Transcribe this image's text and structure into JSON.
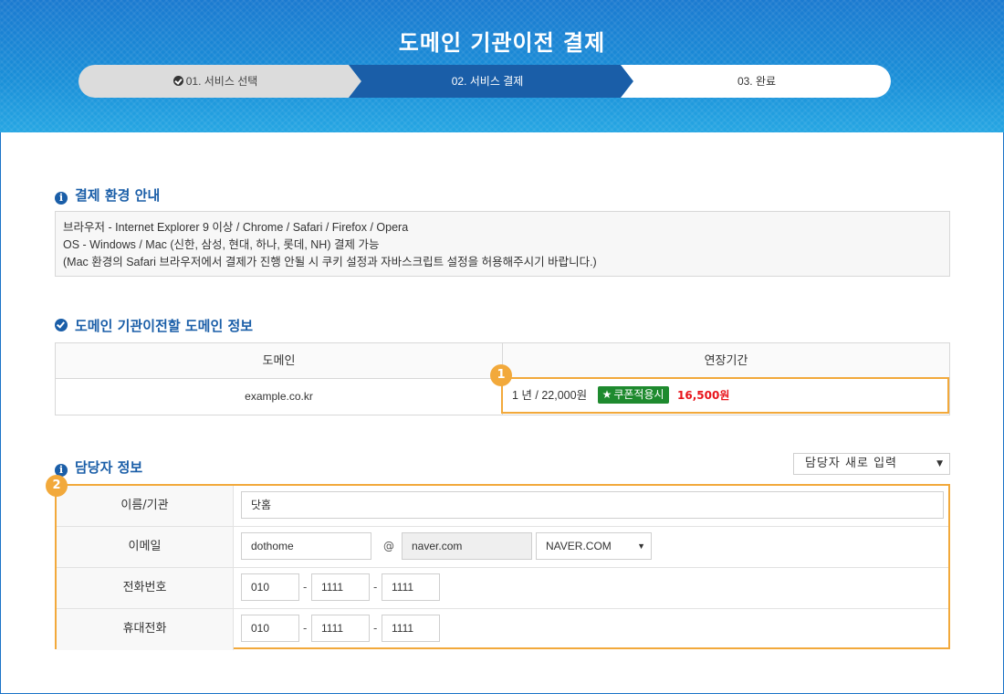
{
  "header": {
    "title": "도메인 기관이전 결제",
    "steps": [
      {
        "label": "01. 서비스 선택",
        "state": "done"
      },
      {
        "label": "02. 서비스 결제",
        "state": "active"
      },
      {
        "label": "03. 완료",
        "state": "pending"
      }
    ]
  },
  "payment_env": {
    "title": "결제 환경 안내",
    "lines": [
      "브라우저 - Internet Explorer 9 이상 / Chrome / Safari / Firefox / Opera",
      "OS - Windows / Mac (신한, 삼성, 현대, 하나, 롯데, NH) 결제 가능",
      "(Mac 환경의 Safari 브라우저에서 결제가 진행 안될 시 쿠키 설정과 자바스크립트 설정을 허용해주시기 바랍니다.)"
    ]
  },
  "domain_info": {
    "title": "도메인 기관이전할 도메인 정보",
    "col_domain": "도메인",
    "col_period": "연장기간",
    "domain": "example.co.kr",
    "period": "1 년 / 22,000원",
    "coupon_label": "쿠폰적용시",
    "coupon_price": "16,500원",
    "badge": "1"
  },
  "contact": {
    "title": "담당자 정보",
    "badge": "2",
    "select_value": "담당자 새로 입력",
    "rows": {
      "name_label": "이름/기관",
      "name_value": "닷홈",
      "email_label": "이메일",
      "email_id": "dothome",
      "email_at": "@",
      "email_domain": "naver.com",
      "email_domain_select": "NAVER.COM",
      "phone_label": "전화번호",
      "phone": [
        "010",
        "1111",
        "1111"
      ],
      "mobile_label": "휴대전화",
      "mobile": [
        "010",
        "1111",
        "1111"
      ],
      "dash": "-"
    }
  },
  "colors": {
    "primary": "#1a5ea8",
    "accent_orange": "#f2a93b",
    "coupon_green": "#1e8a2e",
    "price_red": "#e8141b"
  }
}
